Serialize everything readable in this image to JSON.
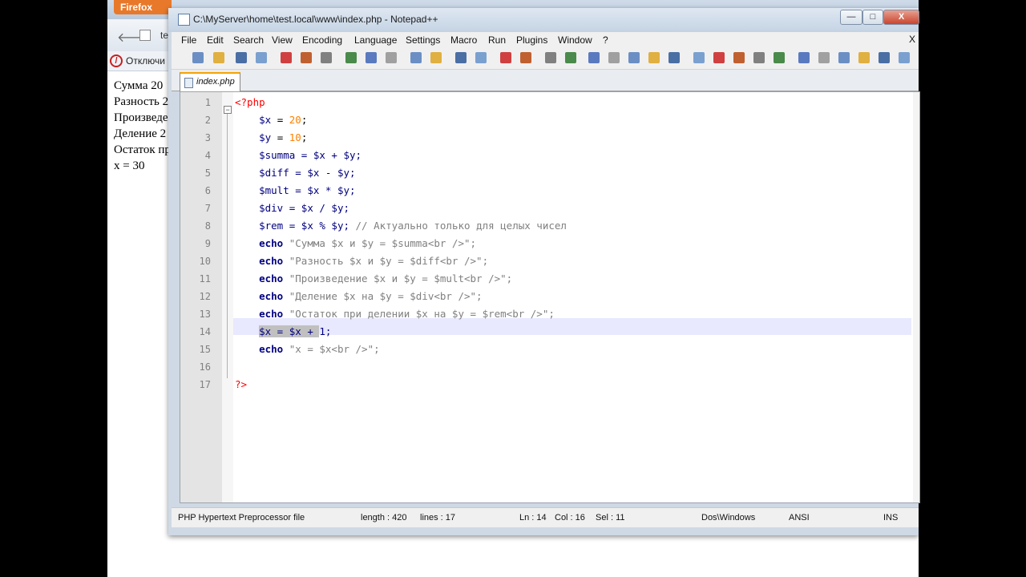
{
  "firefox": {
    "tab_label": "Firefox",
    "url_fragment": "te",
    "bookmark_label": "Отключи",
    "output_lines": [
      "Сумма 20",
      "Разность 2",
      "Произведе",
      "Деление 2",
      "Остаток пр",
      "x = 30"
    ]
  },
  "npp": {
    "title": "C:\\MyServer\\home\\test.local\\www\\index.php - Notepad++",
    "menu": [
      "File",
      "Edit",
      "Search",
      "View",
      "Encoding",
      "Language",
      "Settings",
      "Macro",
      "Run",
      "Plugins",
      "Window",
      "?"
    ],
    "menu_close": "X",
    "tab": "index.php",
    "window_buttons": {
      "minimize": "—",
      "maximize": "□",
      "close": "X"
    },
    "line_numbers": [
      "1",
      "2",
      "3",
      "4",
      "5",
      "6",
      "7",
      "8",
      "9",
      "10",
      "11",
      "12",
      "13",
      "14",
      "15",
      "16",
      "17"
    ],
    "code": {
      "l1": "<?php",
      "l2_var": "$x",
      "l2_eq": " = ",
      "l2_num": "20",
      "l2_end": ";",
      "l3_var": "$y",
      "l3_eq": " = ",
      "l3_num": "10",
      "l3_end": ";",
      "l4": "$summa = $x + $y;",
      "l5": "$diff = $x - $y;",
      "l6": "$mult = $x * $y;",
      "l7": "$div = $x / $y;",
      "l8_code": "$rem = $x % $y; ",
      "l8_comment": "// Актуально только для целых чисел",
      "l9_kw": "echo",
      "l9_str": " \"Сумма $x и $y = $summa<br />\";",
      "l10_kw": "echo",
      "l10_str": " \"Разность $x и $y = $diff<br />\";",
      "l11_kw": "echo",
      "l11_str": " \"Произведение $x и $y = $mult<br />\";",
      "l12_kw": "echo",
      "l12_str": " \"Деление $x на $y = $div<br />\";",
      "l13_kw": "echo",
      "l13_str": " \"Остаток при делении $x на $y = $rem<br />\";",
      "l14_sel": "$x = $x + ",
      "l14_rest": "1;",
      "l15_kw": "echo",
      "l15_str": " \"x = $x<br />\";",
      "l17": "?>"
    },
    "status": {
      "file_type": "PHP Hypertext Preprocessor file",
      "length": "length : 420",
      "lines": "lines : 17",
      "ln": "Ln : 14",
      "col": "Col : 16",
      "sel": "Sel : 11",
      "eol": "Dos\\Windows",
      "encoding": "ANSI",
      "mode": "INS"
    }
  },
  "toolbar_icons": [
    "new-icon",
    "open-icon",
    "save-icon",
    "save-all-icon",
    "close-icon",
    "close-all-icon",
    "print-icon",
    "cut-icon",
    "copy-icon",
    "paste-icon",
    "undo-icon",
    "redo-icon",
    "find-icon",
    "replace-icon",
    "zoom-in-icon",
    "zoom-out-icon",
    "sync-v-icon",
    "sync-h-icon",
    "word-wrap-icon",
    "all-chars-icon",
    "indent-guide-icon",
    "user-lang-icon",
    "doc-map-icon",
    "record-macro-icon",
    "stop-macro-icon",
    "play-macro-icon",
    "run-macro-icon",
    "save-macro-icon",
    "sum-icon",
    "up-icon",
    "down-icon",
    "trim-icon",
    "spell-icon",
    "filter-icon"
  ],
  "colors": {
    "keyword": "#000080",
    "string": "#808080",
    "number": "#ff8000",
    "tag": "#ff0000",
    "tab_accent": "#f6a300"
  }
}
